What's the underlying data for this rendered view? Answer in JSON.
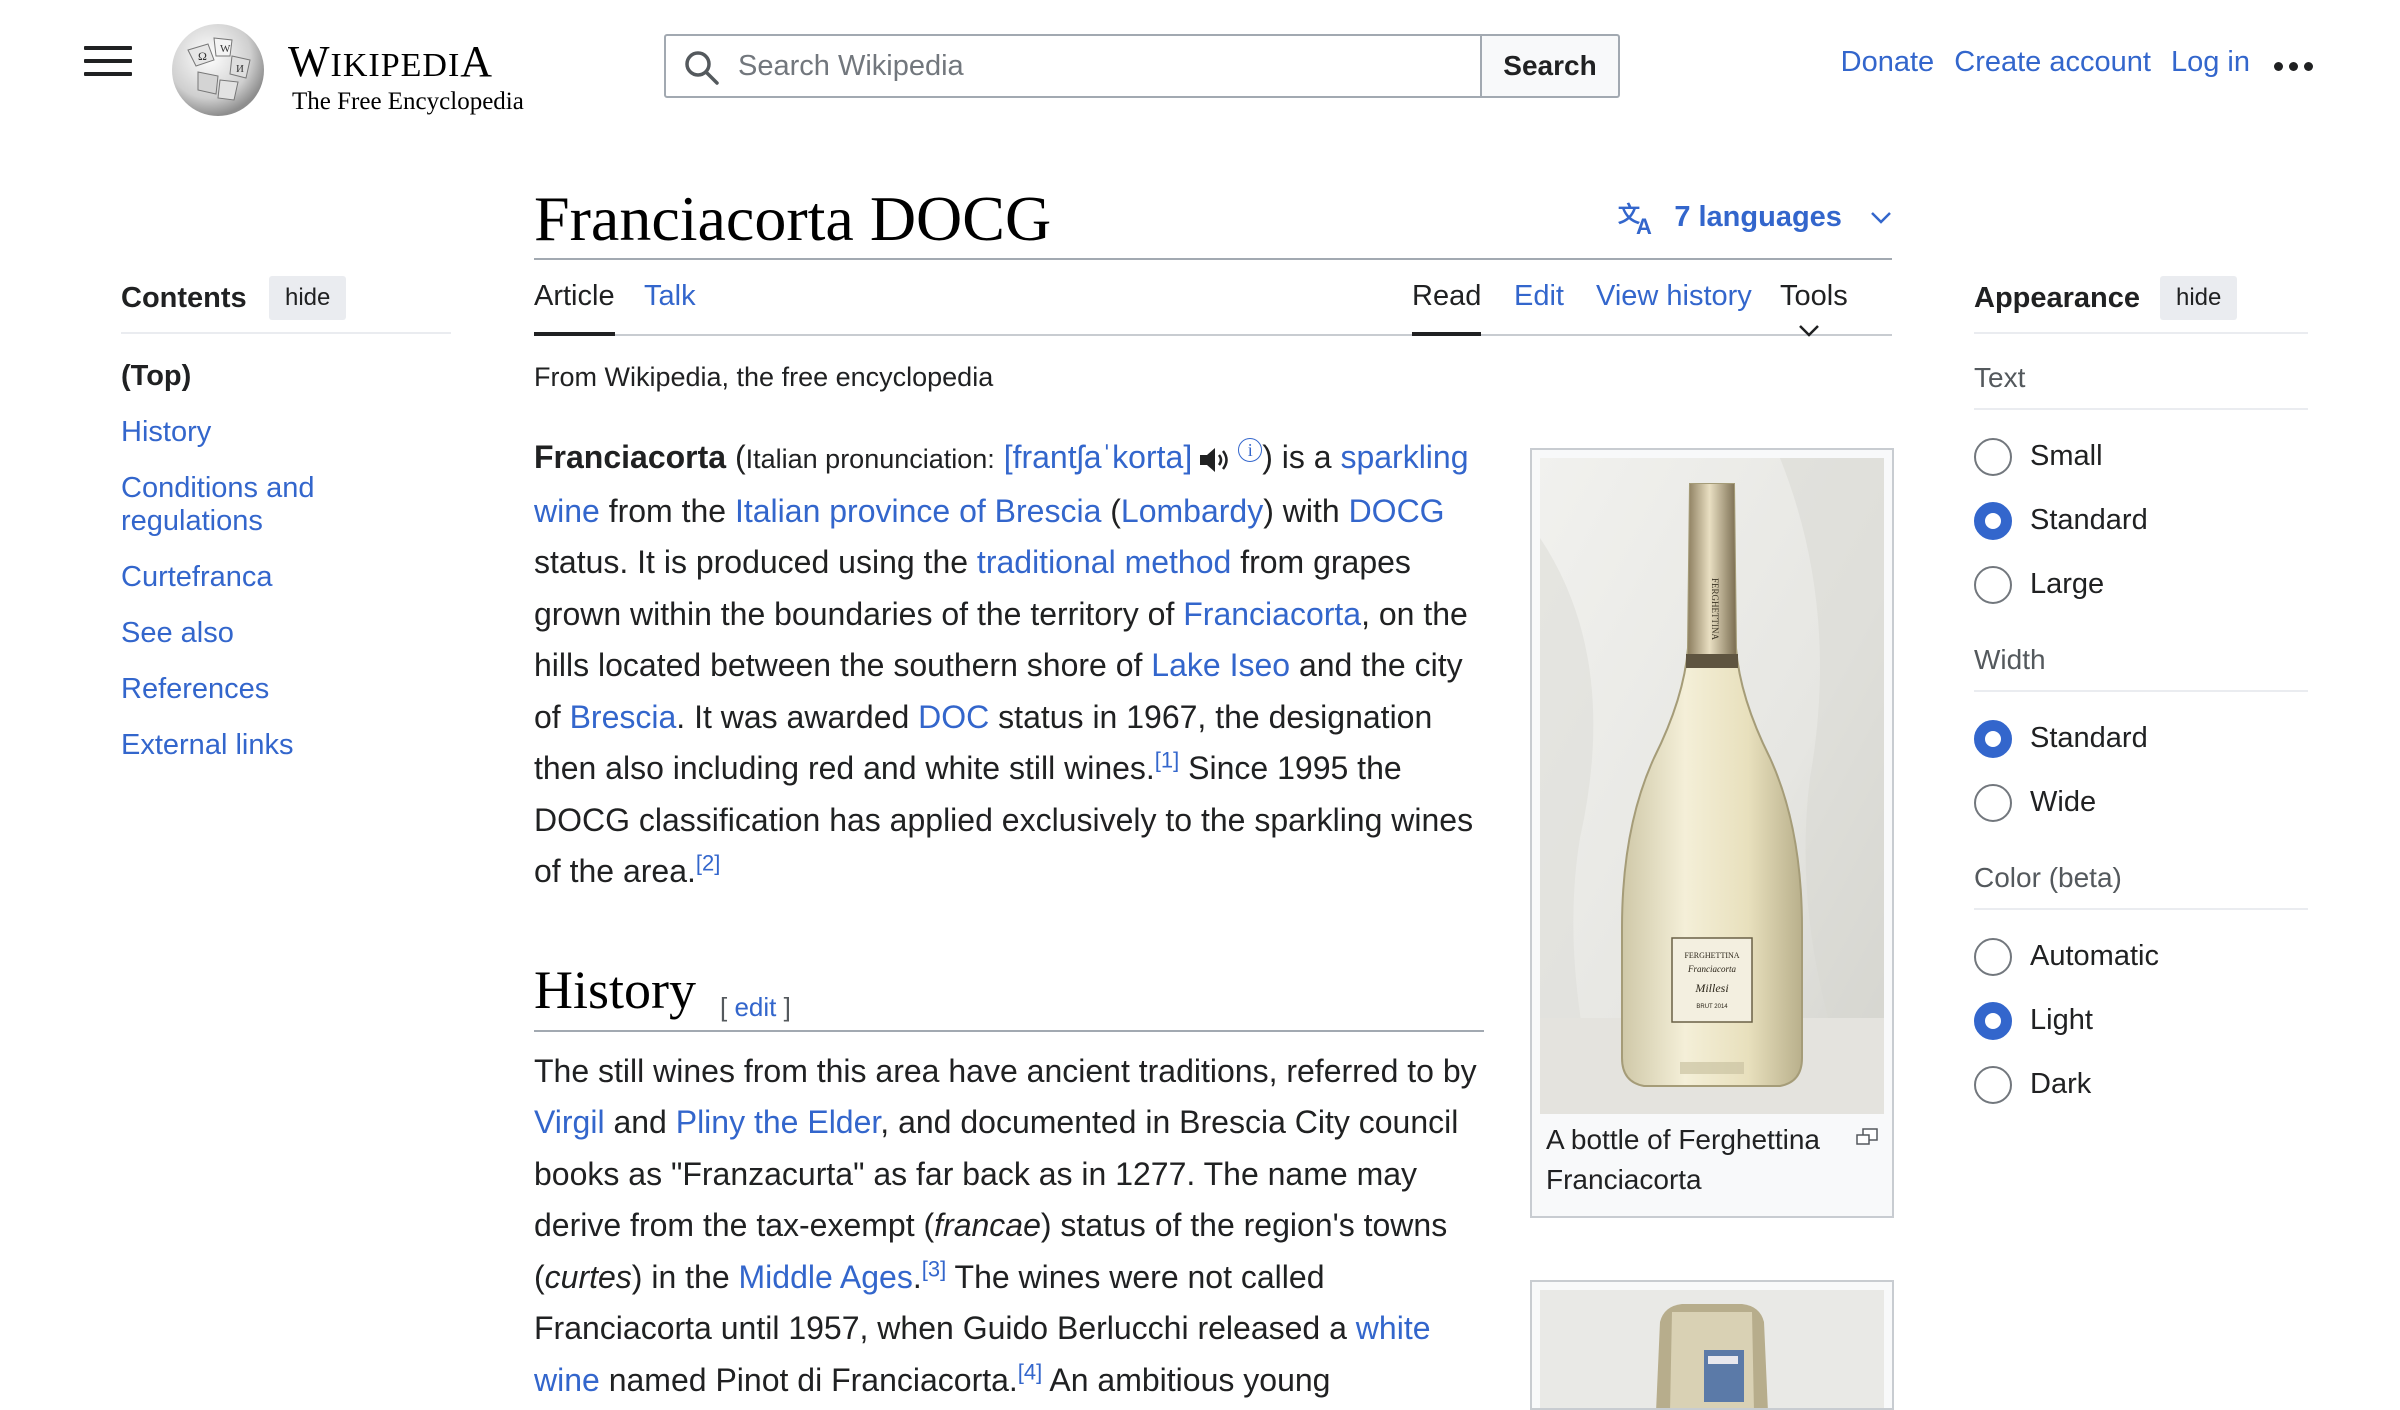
{
  "header": {
    "logo_title": "Wikipedia",
    "logo_tagline": "The Free Encyclopedia",
    "search_placeholder": "Search Wikipedia",
    "search_button": "Search",
    "donate": "Donate",
    "create_account": "Create account",
    "log_in": "Log in"
  },
  "toc": {
    "title": "Contents",
    "hide": "hide",
    "items": [
      "(Top)",
      "History",
      "Conditions and regulations",
      "Curtefranca",
      "See also",
      "References",
      "External links"
    ]
  },
  "page": {
    "title": "Franciacorta DOCG",
    "languages": "7 languages",
    "tabs": {
      "article": "Article",
      "talk": "Talk",
      "read": "Read",
      "edit": "Edit",
      "history": "View history",
      "tools": "Tools"
    },
    "tagline": "From Wikipedia, the free encyclopedia"
  },
  "intro": {
    "bold_term": "Franciacorta",
    "pron_label": "Italian pronunciation:",
    "ipa": "[frantʃaˈkorta]",
    "t1": ") is a",
    "link_sparkling_wine": "sparkling wine",
    "t2": "from the",
    "link_province": "Italian province of Brescia",
    "link_lombardy": "Lombardy",
    "t3": "with",
    "link_docg": "DOCG",
    "t4": "status. It is produced using the",
    "link_traditional": "traditional method",
    "t5": "from grapes grown within the boundaries of the territory of",
    "link_franciacorta": "Franciacorta",
    "t6": ", on the hills located between the southern shore of",
    "link_iseo": "Lake Iseo",
    "t7": "and the city of",
    "link_brescia": "Brescia",
    "t8": ". It was awarded",
    "link_doc": "DOC",
    "t9": "status in 1967, the designation then also including red and white still wines.",
    "ref1": "[1]",
    "t10": "Since 1995 the DOCG classification has applied exclusively to the sparkling wines of the area.",
    "ref2": "[2]"
  },
  "history": {
    "heading": "History",
    "edit": "edit",
    "t1": "The still wines from this area have ancient traditions, referred to by",
    "link_virgil": "Virgil",
    "t2": "and",
    "link_pliny": "Pliny the Elder",
    "t3": ", and documented in Brescia City council books as \"Franzacurta\" as far back as in 1277. The name may derive from the tax-exempt (",
    "em_francae": "francae",
    "t4": ") status of the region's towns (",
    "em_curtes": "curtes",
    "t5": ") in the",
    "link_middle_ages": "Middle Ages",
    "ref3": "[3]",
    "t6": "The wines were not called Franciacorta until 1957, when Guido Berlucchi released a",
    "link_white_wine": "white wine",
    "t7": "named Pinot di Franciacorta.",
    "ref4": "[4]",
    "t8": "An ambitious young"
  },
  "figure": {
    "caption": "A bottle of Ferghettina Franciacorta",
    "bottle_label": [
      "FERGHETTINA",
      "Franciacorta",
      "Millesi",
      "BRUT 2014"
    ]
  },
  "appearance": {
    "title": "Appearance",
    "hide": "hide",
    "text_label": "Text",
    "text_options": [
      "Small",
      "Standard",
      "Large"
    ],
    "text_selected": "Standard",
    "width_label": "Width",
    "width_options": [
      "Standard",
      "Wide"
    ],
    "width_selected": "Standard",
    "color_label": "Color (beta)",
    "color_options": [
      "Automatic",
      "Light",
      "Dark"
    ],
    "color_selected": "Light"
  },
  "colors": {
    "link": "#3366cc",
    "text": "#202122",
    "border": "#a2a9b1"
  }
}
